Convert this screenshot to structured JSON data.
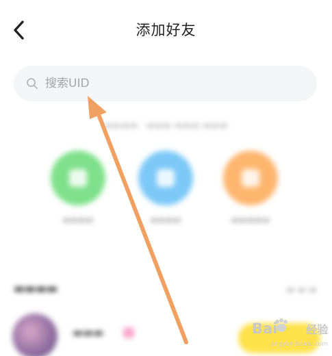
{
  "header": {
    "title": "添加好友",
    "back_icon": "chevron-left-icon"
  },
  "search": {
    "placeholder": "搜索UID",
    "icon": "search-icon"
  },
  "quick_actions": [
    {
      "color": "#7ee08a"
    },
    {
      "color": "#7cc8f7"
    },
    {
      "color": "#fdb56e"
    }
  ],
  "annotation": {
    "arrow_color": "#f0a060"
  },
  "watermark": {
    "text": "Bai",
    "text2": "经验",
    "sub": "jingyan.baidu.com"
  }
}
